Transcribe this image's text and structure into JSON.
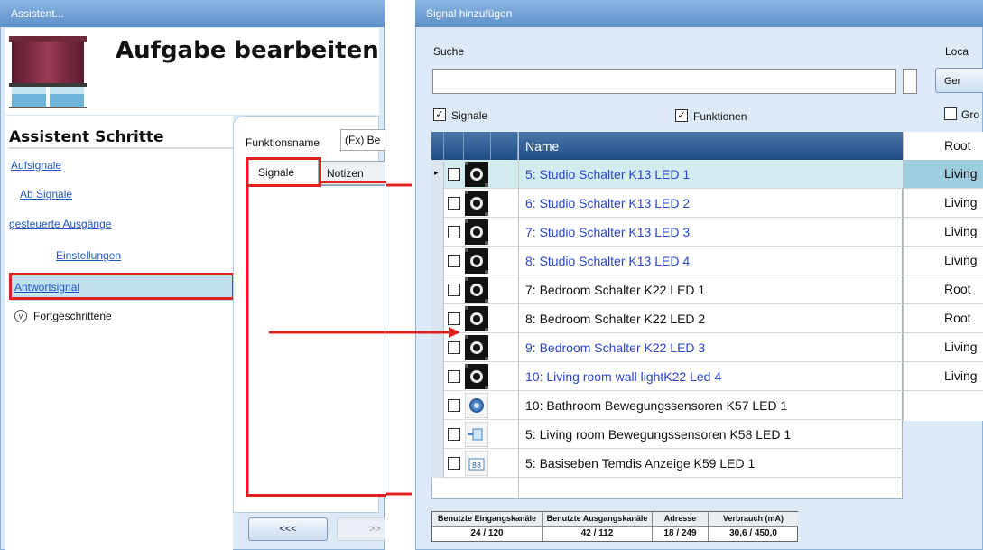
{
  "left_window": {
    "title": "Assistent...",
    "page_title": "Aufgabe bearbeiten",
    "steps_title": "Assistent Schritte",
    "steps": [
      {
        "label": "Aufsignale"
      },
      {
        "label": "Ab Signale"
      },
      {
        "label": "gesteuerte Ausgänge"
      },
      {
        "label": "Einstellungen"
      },
      {
        "label": "Antwortsignal"
      }
    ],
    "advanced_label": "Fortgeschrittene",
    "function_name_label": "Funktionsname",
    "function_name_value": "(Fx) Be",
    "tabs": [
      {
        "label": "Signale"
      },
      {
        "label": "Notizen"
      }
    ],
    "prev_button": "<<<",
    "next_button": ">>"
  },
  "right_window": {
    "title": "Signal hinzufügen",
    "search_label": "Suche",
    "search_value": "",
    "location_label": "Loca",
    "gen_button": "Ger",
    "filters": [
      {
        "label": "Signale",
        "checked": true
      },
      {
        "label": "Funktionen",
        "checked": true
      },
      {
        "label": "Gro",
        "checked": false
      }
    ],
    "table": {
      "header_name": "Name",
      "rows": [
        {
          "name": "5: Studio Schalter K13 LED 1",
          "location": "Living",
          "icon": "switch-icon",
          "selected": true
        },
        {
          "name": "6: Studio Schalter K13 LED 2",
          "location": "Living",
          "icon": "switch-icon"
        },
        {
          "name": "7: Studio Schalter K13 LED 3",
          "location": "Living",
          "icon": "switch-icon"
        },
        {
          "name": "8: Studio Schalter K13 LED 4",
          "location": "Living",
          "icon": "switch-icon"
        },
        {
          "name": "7: Bedroom Schalter K22 LED 1",
          "location": "Root",
          "icon": "switch-icon"
        },
        {
          "name": "8: Bedroom Schalter K22 LED 2",
          "location": "Root",
          "icon": "switch-icon"
        },
        {
          "name": "9: Bedroom Schalter K22 LED 3",
          "location": "Living",
          "icon": "switch-icon"
        },
        {
          "name": "10: Living room wall lightK22 Led 4",
          "location": "Living",
          "icon": "switch-icon"
        },
        {
          "name": "10: Bathroom Bewegungssensoren K57 LED 1",
          "location": "",
          "icon": "motion-sensor-icon"
        },
        {
          "name": "5: Living room Bewegungssensoren K58 LED 1",
          "location": "",
          "icon": "sensor-module-icon"
        },
        {
          "name": "5: Basiseben Temdis Anzeige K59 LED 1",
          "location": "",
          "icon": "display-icon"
        }
      ],
      "location_header": "Root"
    },
    "stats": {
      "headers": [
        "Benutzte Eingangskanäle",
        "Benutzte Ausgangskanäle",
        "Adresse",
        "Verbrauch (mA)"
      ],
      "values": [
        "24 / 120",
        "42 / 112",
        "18 / 249",
        "30,6 / 450,0"
      ]
    }
  },
  "colors": {
    "title_bar": "#5d8fc8",
    "highlight_red": "#e02020",
    "link_blue": "#1f57c8",
    "table_header": "#1e4d86",
    "selected_row": "#d2ecef"
  }
}
